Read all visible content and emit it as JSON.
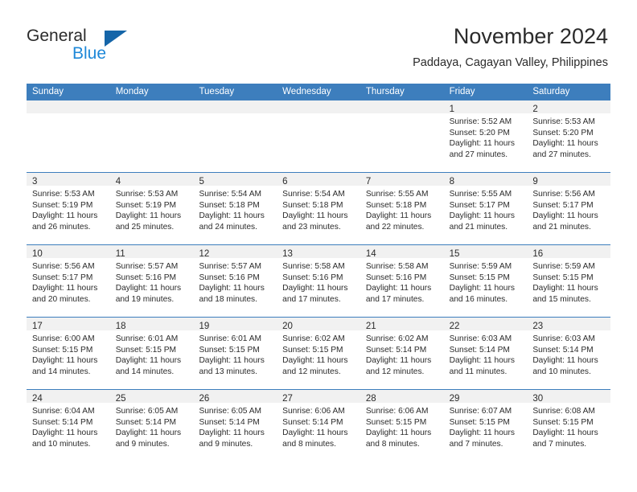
{
  "brand": {
    "name_part1": "General",
    "name_part2": "Blue",
    "accent_color": "#1e88d8",
    "triangle_color": "#1565a8"
  },
  "header": {
    "title": "November 2024",
    "subtitle": "Paddaya, Cagayan Valley, Philippines"
  },
  "theme": {
    "header_row_color": "#3d7ebd",
    "cell_head_color": "#f1f1f1",
    "text_color": "#2b2b2b"
  },
  "weekdays": [
    "Sunday",
    "Monday",
    "Tuesday",
    "Wednesday",
    "Thursday",
    "Friday",
    "Saturday"
  ],
  "weeks": [
    [
      {
        "day": "",
        "sunrise": "",
        "sunset": "",
        "daylight1": "",
        "daylight2": ""
      },
      {
        "day": "",
        "sunrise": "",
        "sunset": "",
        "daylight1": "",
        "daylight2": ""
      },
      {
        "day": "",
        "sunrise": "",
        "sunset": "",
        "daylight1": "",
        "daylight2": ""
      },
      {
        "day": "",
        "sunrise": "",
        "sunset": "",
        "daylight1": "",
        "daylight2": ""
      },
      {
        "day": "",
        "sunrise": "",
        "sunset": "",
        "daylight1": "",
        "daylight2": ""
      },
      {
        "day": "1",
        "sunrise": "Sunrise: 5:52 AM",
        "sunset": "Sunset: 5:20 PM",
        "daylight1": "Daylight: 11 hours",
        "daylight2": "and 27 minutes."
      },
      {
        "day": "2",
        "sunrise": "Sunrise: 5:53 AM",
        "sunset": "Sunset: 5:20 PM",
        "daylight1": "Daylight: 11 hours",
        "daylight2": "and 27 minutes."
      }
    ],
    [
      {
        "day": "3",
        "sunrise": "Sunrise: 5:53 AM",
        "sunset": "Sunset: 5:19 PM",
        "daylight1": "Daylight: 11 hours",
        "daylight2": "and 26 minutes."
      },
      {
        "day": "4",
        "sunrise": "Sunrise: 5:53 AM",
        "sunset": "Sunset: 5:19 PM",
        "daylight1": "Daylight: 11 hours",
        "daylight2": "and 25 minutes."
      },
      {
        "day": "5",
        "sunrise": "Sunrise: 5:54 AM",
        "sunset": "Sunset: 5:18 PM",
        "daylight1": "Daylight: 11 hours",
        "daylight2": "and 24 minutes."
      },
      {
        "day": "6",
        "sunrise": "Sunrise: 5:54 AM",
        "sunset": "Sunset: 5:18 PM",
        "daylight1": "Daylight: 11 hours",
        "daylight2": "and 23 minutes."
      },
      {
        "day": "7",
        "sunrise": "Sunrise: 5:55 AM",
        "sunset": "Sunset: 5:18 PM",
        "daylight1": "Daylight: 11 hours",
        "daylight2": "and 22 minutes."
      },
      {
        "day": "8",
        "sunrise": "Sunrise: 5:55 AM",
        "sunset": "Sunset: 5:17 PM",
        "daylight1": "Daylight: 11 hours",
        "daylight2": "and 21 minutes."
      },
      {
        "day": "9",
        "sunrise": "Sunrise: 5:56 AM",
        "sunset": "Sunset: 5:17 PM",
        "daylight1": "Daylight: 11 hours",
        "daylight2": "and 21 minutes."
      }
    ],
    [
      {
        "day": "10",
        "sunrise": "Sunrise: 5:56 AM",
        "sunset": "Sunset: 5:17 PM",
        "daylight1": "Daylight: 11 hours",
        "daylight2": "and 20 minutes."
      },
      {
        "day": "11",
        "sunrise": "Sunrise: 5:57 AM",
        "sunset": "Sunset: 5:16 PM",
        "daylight1": "Daylight: 11 hours",
        "daylight2": "and 19 minutes."
      },
      {
        "day": "12",
        "sunrise": "Sunrise: 5:57 AM",
        "sunset": "Sunset: 5:16 PM",
        "daylight1": "Daylight: 11 hours",
        "daylight2": "and 18 minutes."
      },
      {
        "day": "13",
        "sunrise": "Sunrise: 5:58 AM",
        "sunset": "Sunset: 5:16 PM",
        "daylight1": "Daylight: 11 hours",
        "daylight2": "and 17 minutes."
      },
      {
        "day": "14",
        "sunrise": "Sunrise: 5:58 AM",
        "sunset": "Sunset: 5:16 PM",
        "daylight1": "Daylight: 11 hours",
        "daylight2": "and 17 minutes."
      },
      {
        "day": "15",
        "sunrise": "Sunrise: 5:59 AM",
        "sunset": "Sunset: 5:15 PM",
        "daylight1": "Daylight: 11 hours",
        "daylight2": "and 16 minutes."
      },
      {
        "day": "16",
        "sunrise": "Sunrise: 5:59 AM",
        "sunset": "Sunset: 5:15 PM",
        "daylight1": "Daylight: 11 hours",
        "daylight2": "and 15 minutes."
      }
    ],
    [
      {
        "day": "17",
        "sunrise": "Sunrise: 6:00 AM",
        "sunset": "Sunset: 5:15 PM",
        "daylight1": "Daylight: 11 hours",
        "daylight2": "and 14 minutes."
      },
      {
        "day": "18",
        "sunrise": "Sunrise: 6:01 AM",
        "sunset": "Sunset: 5:15 PM",
        "daylight1": "Daylight: 11 hours",
        "daylight2": "and 14 minutes."
      },
      {
        "day": "19",
        "sunrise": "Sunrise: 6:01 AM",
        "sunset": "Sunset: 5:15 PM",
        "daylight1": "Daylight: 11 hours",
        "daylight2": "and 13 minutes."
      },
      {
        "day": "20",
        "sunrise": "Sunrise: 6:02 AM",
        "sunset": "Sunset: 5:15 PM",
        "daylight1": "Daylight: 11 hours",
        "daylight2": "and 12 minutes."
      },
      {
        "day": "21",
        "sunrise": "Sunrise: 6:02 AM",
        "sunset": "Sunset: 5:14 PM",
        "daylight1": "Daylight: 11 hours",
        "daylight2": "and 12 minutes."
      },
      {
        "day": "22",
        "sunrise": "Sunrise: 6:03 AM",
        "sunset": "Sunset: 5:14 PM",
        "daylight1": "Daylight: 11 hours",
        "daylight2": "and 11 minutes."
      },
      {
        "day": "23",
        "sunrise": "Sunrise: 6:03 AM",
        "sunset": "Sunset: 5:14 PM",
        "daylight1": "Daylight: 11 hours",
        "daylight2": "and 10 minutes."
      }
    ],
    [
      {
        "day": "24",
        "sunrise": "Sunrise: 6:04 AM",
        "sunset": "Sunset: 5:14 PM",
        "daylight1": "Daylight: 11 hours",
        "daylight2": "and 10 minutes."
      },
      {
        "day": "25",
        "sunrise": "Sunrise: 6:05 AM",
        "sunset": "Sunset: 5:14 PM",
        "daylight1": "Daylight: 11 hours",
        "daylight2": "and 9 minutes."
      },
      {
        "day": "26",
        "sunrise": "Sunrise: 6:05 AM",
        "sunset": "Sunset: 5:14 PM",
        "daylight1": "Daylight: 11 hours",
        "daylight2": "and 9 minutes."
      },
      {
        "day": "27",
        "sunrise": "Sunrise: 6:06 AM",
        "sunset": "Sunset: 5:14 PM",
        "daylight1": "Daylight: 11 hours",
        "daylight2": "and 8 minutes."
      },
      {
        "day": "28",
        "sunrise": "Sunrise: 6:06 AM",
        "sunset": "Sunset: 5:15 PM",
        "daylight1": "Daylight: 11 hours",
        "daylight2": "and 8 minutes."
      },
      {
        "day": "29",
        "sunrise": "Sunrise: 6:07 AM",
        "sunset": "Sunset: 5:15 PM",
        "daylight1": "Daylight: 11 hours",
        "daylight2": "and 7 minutes."
      },
      {
        "day": "30",
        "sunrise": "Sunrise: 6:08 AM",
        "sunset": "Sunset: 5:15 PM",
        "daylight1": "Daylight: 11 hours",
        "daylight2": "and 7 minutes."
      }
    ]
  ]
}
